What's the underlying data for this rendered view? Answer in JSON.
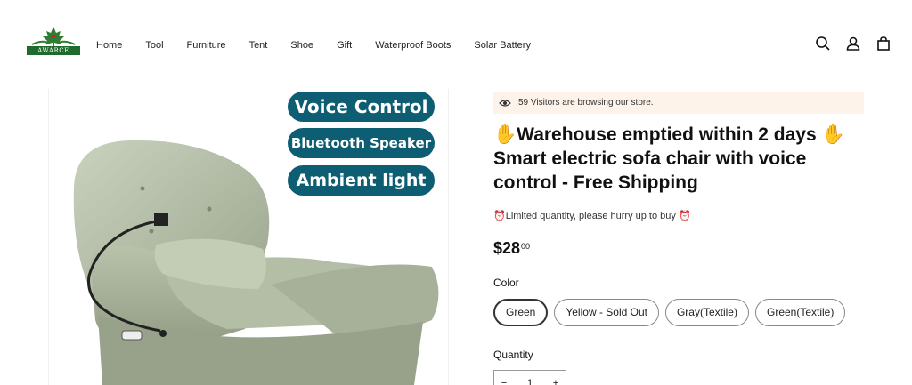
{
  "brand": {
    "logo_text": "AWARCE"
  },
  "nav": {
    "items": [
      "Home",
      "Tool",
      "Furniture",
      "Tent",
      "Shoe",
      "Gift",
      "Waterproof Boots",
      "Solar Battery"
    ]
  },
  "header_icons": [
    "search-icon",
    "account-icon",
    "cart-icon"
  ],
  "product_image": {
    "badges": [
      "Voice Control",
      "Bluetooth Speaker",
      "Ambient light"
    ]
  },
  "product": {
    "visitors_text": "59 Visitors are browsing our store.",
    "title_line1": "Warehouse emptied within 2 days",
    "title_rest": "Smart electric sofa chair with voice control - Free Shipping",
    "limited_text": "Limited quantity, please hurry up to buy",
    "price_main": "$28",
    "price_cents": "00",
    "color_label": "Color",
    "colors": [
      "Green",
      "Yellow - Sold Out",
      "Gray(Textile)",
      "Green(Textile)"
    ],
    "selected_color": "Green",
    "quantity_label": "Quantity",
    "quantity_value": "1",
    "qty_minus": "−",
    "qty_plus": "+"
  },
  "colors": {
    "badge_bg": "#0e5e73",
    "visitor_bg": "#fdf3ea",
    "logo_green": "#1f6b2e",
    "hand_yellow": "#f5b400"
  }
}
